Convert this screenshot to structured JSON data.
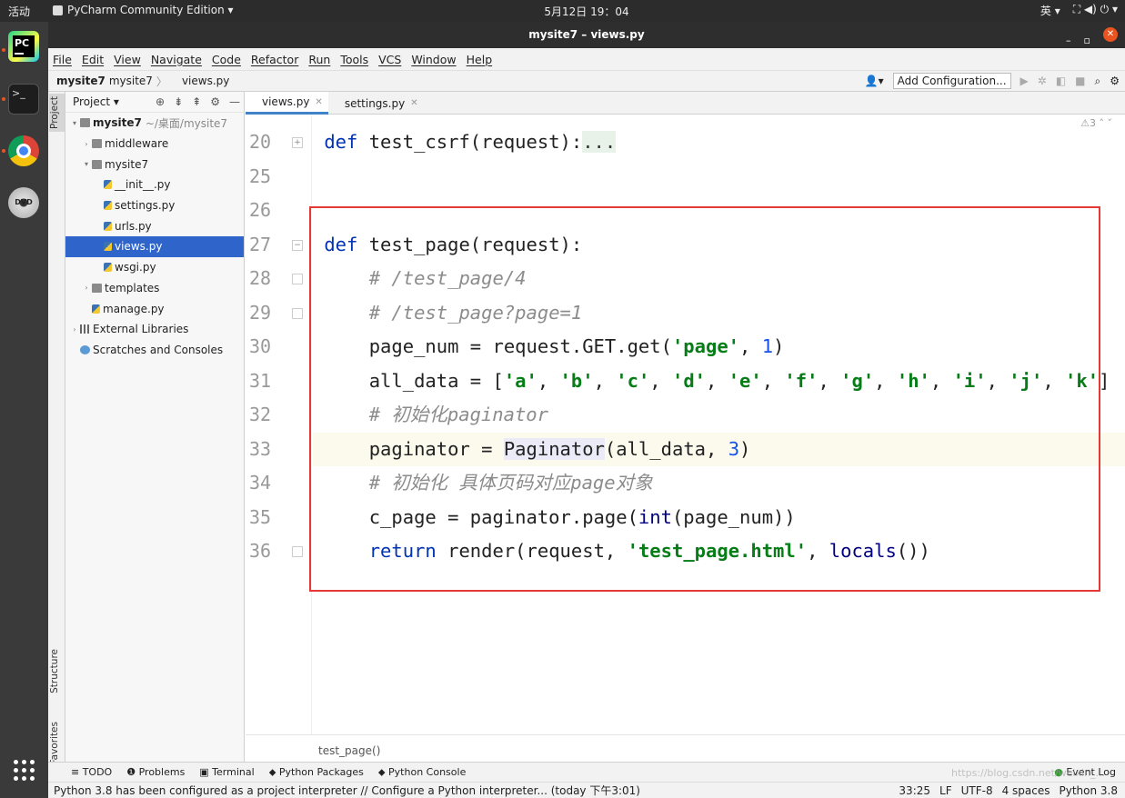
{
  "system_bar": {
    "activities": "活动",
    "app_menu": "PyCharm Community Edition ▾",
    "clock": "5月12日  19：04",
    "ime": "英 ▾",
    "status_icons": "⛶ ◀) ⏻ ▾"
  },
  "dock": {
    "terminal_glyph": ">_",
    "dvd_label": "DVD"
  },
  "window": {
    "title": "mysite7 – views.py",
    "min": "–",
    "max": "▫",
    "close": "✕"
  },
  "menu": [
    "File",
    "Edit",
    "View",
    "Navigate",
    "Code",
    "Refactor",
    "Run",
    "Tools",
    "VCS",
    "Window",
    "Help"
  ],
  "navbar": {
    "crumbs": [
      "mysite7",
      "mysite7",
      "views.py"
    ],
    "add_configuration": "Add Configuration..."
  },
  "sidebar": {
    "project": "Project",
    "structure": "Structure",
    "favorites": "Favorites"
  },
  "project_panel": {
    "header": "Project ▾",
    "tree": [
      {
        "label": "mysite7",
        "dim": "~/桌面/mysite7",
        "icon": "folder",
        "toggle": "▾"
      },
      {
        "label": "middleware",
        "icon": "folder",
        "toggle": "›"
      },
      {
        "label": "mysite7",
        "icon": "folder",
        "toggle": "▾"
      },
      {
        "label": "__init__.py",
        "icon": "py"
      },
      {
        "label": "settings.py",
        "icon": "py"
      },
      {
        "label": "urls.py",
        "icon": "py"
      },
      {
        "label": "views.py",
        "icon": "py",
        "selected": true
      },
      {
        "label": "wsgi.py",
        "icon": "py"
      },
      {
        "label": "templates",
        "icon": "folder",
        "toggle": "›"
      },
      {
        "label": "manage.py",
        "icon": "py"
      },
      {
        "label": "External Libraries",
        "icon": "lib",
        "toggle": "›"
      },
      {
        "label": "Scratches and Consoles",
        "icon": "scr"
      }
    ]
  },
  "tabs": [
    {
      "label": "views.py",
      "active": true
    },
    {
      "label": "settings.py",
      "active": false
    }
  ],
  "editor": {
    "warnings": "⚠3 ˄ ˅",
    "line_numbers": [
      "20",
      "25",
      "26",
      "27",
      "28",
      "29",
      "30",
      "31",
      "32",
      "33",
      "34",
      "35",
      "36"
    ],
    "lines": [
      "def test_csrf(request):...",
      "",
      "",
      "def test_page(request):",
      "    # /test_page/4",
      "    # /test_page?page=1",
      "    page_num = request.GET.get('page', 1)",
      "    all_data = ['a', 'b', 'c', 'd', 'e', 'f', 'g', 'h', 'i', 'j', 'k']",
      "    # 初始化paginator",
      "    paginator = Paginator(all_data, 3)",
      "    # 初始化 具体页码对应page对象",
      "    c_page = paginator.page(int(page_num))",
      "    return render(request, 'test_page.html', locals())"
    ],
    "breadcrumb": "test_page()"
  },
  "bottom_tabs": [
    "≡ TODO",
    "❶ Problems",
    "▣ Terminal",
    "⬥ Python Packages",
    "⬥ Python Console"
  ],
  "event_log": "Event Log",
  "status": {
    "message": "Python 3.8 has been configured as a project interpreter // Configure a Python interpreter... (today 下午3:01)",
    "position": "33:25",
    "line_sep": "LF",
    "encoding": "UTF-8",
    "indent": "4 spaces",
    "interpreter": "Python 3.8"
  },
  "watermark": "https://blog.csdn.net/weixin_..."
}
